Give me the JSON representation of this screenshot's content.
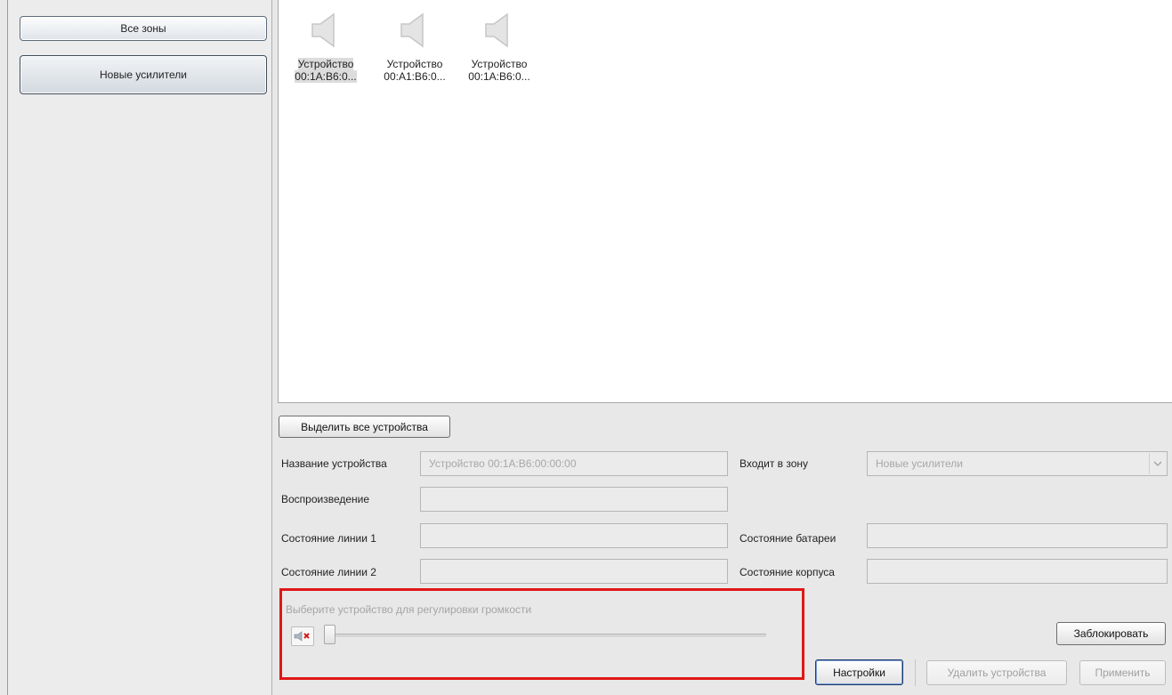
{
  "sidebar": {
    "zones": [
      {
        "label": "Все зоны"
      },
      {
        "label": "Новые усилители"
      }
    ]
  },
  "devices": [
    {
      "name": "Устройство",
      "address": "00:1A:B6:0..."
    },
    {
      "name": "Устройство",
      "address": "00:A1:B6:0..."
    },
    {
      "name": "Устройство",
      "address": "00:1A:B6:0..."
    }
  ],
  "actions": {
    "select_all": "Выделить все устройства",
    "lock": "Заблокировать",
    "settings": "Настройки",
    "delete_devices": "Удалить устройства",
    "apply": "Применить"
  },
  "form": {
    "device_name_label": "Название устройства",
    "device_name_value": "Устройство 00:1A:B6:00:00:00",
    "zone_label": "Входит в зону",
    "zone_value": "Новые усилители",
    "playback_label": "Воспроизведение",
    "playback_value": "",
    "line1_label": "Состояние линии 1",
    "line1_value": "",
    "battery_label": "Состояние батареи",
    "battery_value": "",
    "line2_label": "Состояние линии 2",
    "line2_value": "",
    "case_label": "Состояние корпуса",
    "case_value": ""
  },
  "volume": {
    "hint": "Выберите устройство для регулировки громкости",
    "level": 0
  },
  "icons": {
    "speaker": "speaker-icon",
    "mute": "mute-icon",
    "dropdown": "chevron-down-icon"
  }
}
